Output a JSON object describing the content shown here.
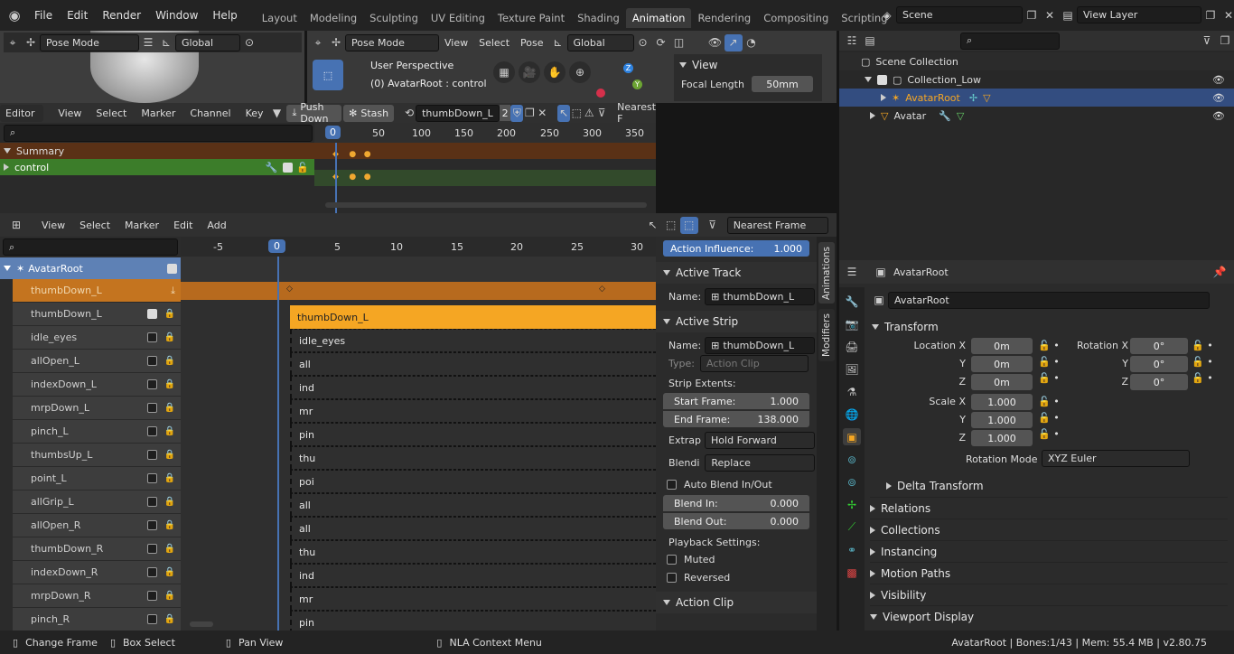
{
  "menu": [
    "File",
    "Edit",
    "Render",
    "Window",
    "Help"
  ],
  "workspaces": [
    "Layout",
    "Modeling",
    "Sculpting",
    "UV Editing",
    "Texture Paint",
    "Shading",
    "Animation",
    "Rendering",
    "Compositing",
    "Scripting"
  ],
  "active_workspace": "Animation",
  "scene": {
    "label": "Scene",
    "view_layer": "View Layer"
  },
  "viewport_left": {
    "mode": "Pose Mode",
    "orientation": "Global"
  },
  "viewport_main": {
    "mode": "Pose Mode",
    "menus": [
      "View",
      "Select",
      "Pose"
    ],
    "orientation": "Global",
    "perspective": "User Perspective",
    "object": "(0) AvatarRoot : control"
  },
  "view_panel": {
    "title": "View",
    "focal_label": "Focal Length",
    "focal_value": "50mm"
  },
  "outliner": {
    "root": "Scene Collection",
    "collection": "Collection_Low",
    "items": [
      {
        "name": "AvatarRoot"
      },
      {
        "name": "Avatar"
      }
    ]
  },
  "dopesheet": {
    "editor": "Editor",
    "menus": [
      "View",
      "Select",
      "Marker",
      "Channel",
      "Key"
    ],
    "push_down": "Push Down",
    "stash": "Stash",
    "action": "thumbDown_L",
    "users": "2",
    "snap": "Nearest F",
    "frames": [
      "0",
      "50",
      "100",
      "150",
      "200",
      "250",
      "300",
      "350"
    ],
    "summary": "Summary",
    "channel": "control"
  },
  "nla": {
    "menus": [
      "View",
      "Select",
      "Marker",
      "Edit",
      "Add"
    ],
    "snap": "Nearest Frame",
    "frames": [
      "-5",
      "0",
      "5",
      "10",
      "15",
      "20",
      "25",
      "30"
    ],
    "root": "AvatarRoot",
    "tracks": [
      "thumbDown_L",
      "thumbDown_L",
      "idle_eyes",
      "allOpen_L",
      "indexDown_L",
      "mrpDown_L",
      "pinch_L",
      "thumbsUp_L",
      "point_L",
      "allGrip_L",
      "allOpen_R",
      "thumbDown_R",
      "indexDown_R",
      "mrpDown_R",
      "pinch_R"
    ],
    "strips": [
      "thumbDown_L",
      "idle_eyes",
      "all",
      "ind",
      "mr",
      "pin",
      "thu",
      "poi",
      "all",
      "all",
      "thu",
      "ind",
      "mr",
      "pin"
    ]
  },
  "sidebar": {
    "influence_label": "Action Influence:",
    "influence_value": "1.000",
    "active_track": "Active Track",
    "name_label": "Name:",
    "track_name": "thumbDown_L",
    "active_strip": "Active Strip",
    "strip_name": "thumbDown_L",
    "type_label": "Type:",
    "type_value": "Action Clip",
    "extents": "Strip Extents:",
    "start_label": "Start Frame:",
    "start_value": "1.000",
    "end_label": "End Frame:",
    "end_value": "138.000",
    "extrap_label": "Extrap",
    "extrap_value": "Hold Forward",
    "blend_label": "Blendi",
    "blend_value": "Replace",
    "auto_blend": "Auto Blend In/Out",
    "blend_in_label": "Blend In:",
    "blend_in_value": "0.000",
    "blend_out_label": "Blend Out:",
    "blend_out_value": "0.000",
    "playback": "Playback Settings:",
    "muted": "Muted",
    "reversed": "Reversed",
    "action_clip": "Action Clip",
    "tabs": [
      "Animations",
      "Modifiers"
    ]
  },
  "properties": {
    "object": "AvatarRoot",
    "object_name": "AvatarRoot",
    "transform": "Transform",
    "loc_label": "Location X",
    "y": "Y",
    "z": "Z",
    "loc": [
      "0m",
      "0m",
      "0m"
    ],
    "rot_label": "Rotation X",
    "rot": [
      "0°",
      "0°",
      "0°"
    ],
    "scale_label": "Scale X",
    "scale": [
      "1.000",
      "1.000",
      "1.000"
    ],
    "rot_mode_label": "Rotation Mode",
    "rot_mode": "XYZ Euler",
    "delta": "Delta Transform",
    "sections": [
      "Relations",
      "Collections",
      "Instancing",
      "Motion Paths",
      "Visibility",
      "Viewport Display"
    ]
  },
  "status": {
    "change_frame": "Change Frame",
    "box_select": "Box Select",
    "pan_view": "Pan View",
    "context": "NLA Context Menu",
    "info": "AvatarRoot | Bones:1/43  | Mem: 55.4 MB | v2.80.75"
  },
  "colors": {
    "accent": "#4772b3",
    "strip": "#f5a623",
    "summary": "#5a3116",
    "channel": "#3c7d2a",
    "track_active": "#c4741f"
  }
}
